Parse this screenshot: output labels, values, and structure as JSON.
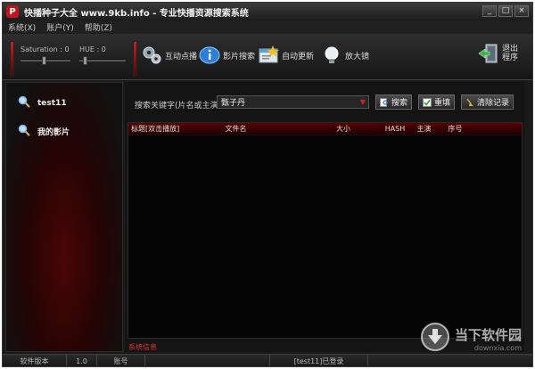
{
  "window": {
    "title": "快播种子大全 www.9kb.info - 专业快播资源搜索系统",
    "app_icon_letter": "P",
    "controls": [
      "_",
      "□",
      "×"
    ]
  },
  "menu": {
    "items": [
      "系统(X)",
      "账户(Y)",
      "帮助(Z)"
    ]
  },
  "toolbar": {
    "saturation_label": "Saturation : 0",
    "hue_label": "HUE : 0",
    "buttons": [
      {
        "label": "互动点播",
        "icon": "gears-icon"
      },
      {
        "label": "影片搜索",
        "icon": "info-icon"
      },
      {
        "label": "自动更新",
        "icon": "update-icon"
      },
      {
        "label": "放大镜",
        "icon": "bulb-icon"
      }
    ],
    "exit_label_1": "退出",
    "exit_label_2": "程序"
  },
  "sidebar": {
    "items": [
      {
        "label": "test11",
        "icon": "magnifier-icon"
      },
      {
        "label": "我的影片",
        "icon": "magnifier-icon"
      }
    ]
  },
  "search": {
    "label": "搜索关键字(片名或主演)",
    "value": "甄子丹",
    "buttons": [
      {
        "label": "搜索",
        "icon": "search-doc-icon"
      },
      {
        "label": "重填",
        "icon": "check-icon"
      },
      {
        "label": "清除记录",
        "icon": "broom-icon"
      }
    ]
  },
  "table": {
    "columns": [
      "标题[双击播放]",
      "文件名",
      "大小",
      "HASH",
      "主演",
      "序号"
    ]
  },
  "system_info_label": "系统信息",
  "statusbar": {
    "cells": [
      "软件版本",
      "1.0",
      "账号",
      "",
      "[test11]已登录",
      ""
    ]
  },
  "watermark": {
    "main": "当下软件园",
    "sub": "downxia.com"
  },
  "colors": {
    "accent_red": "#c0151b",
    "window_bg": "#1a1a1a",
    "header_red": "#5a0000"
  }
}
